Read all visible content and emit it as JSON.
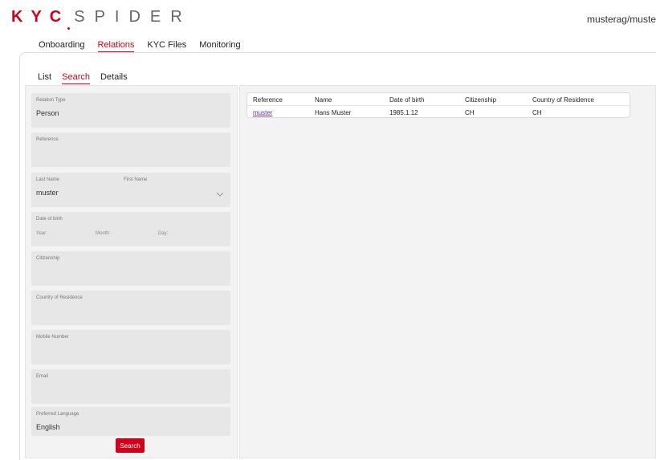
{
  "brand": {
    "left": "KYC",
    "right": "SPIDER"
  },
  "user": {
    "name": "musterag/muste"
  },
  "top_nav": [
    {
      "label": "Onboarding",
      "active": false
    },
    {
      "label": "Relations",
      "active": true
    },
    {
      "label": "KYC Files",
      "active": false
    },
    {
      "label": "Monitoring",
      "active": false
    }
  ],
  "sub_nav": [
    {
      "label": "List",
      "active": false
    },
    {
      "label": "Search",
      "active": true
    },
    {
      "label": "Details",
      "active": false
    }
  ],
  "form": {
    "relation_type": {
      "label": "Relation Type",
      "value": "Person"
    },
    "reference": {
      "label": "Reference",
      "value": ""
    },
    "last_name": {
      "label": "Last Name",
      "value": "muster"
    },
    "first_name": {
      "label": "First Name",
      "value": ""
    },
    "date_of_birth": {
      "label": "Date of birth",
      "year": "Year:",
      "month": "Month:",
      "day": "Day:"
    },
    "citizenship": {
      "label": "Citizenship",
      "value": ""
    },
    "country_of_residence": {
      "label": "Country of Residence",
      "value": ""
    },
    "mobile_number": {
      "label": "Mobile Number",
      "value": ""
    },
    "email": {
      "label": "Email",
      "value": ""
    },
    "preferred_language": {
      "label": "Preferred Language",
      "value": "English"
    },
    "search_label": "Search"
  },
  "results": {
    "columns": [
      "Reference",
      "Name",
      "Date of birth",
      "Citizenship",
      "Country of Residence"
    ],
    "rows": [
      [
        "muster",
        "Hans Muster",
        "1985.1.12",
        "CH",
        "CH"
      ]
    ]
  },
  "colors": {
    "accent": "#d0021b",
    "link": "#6a2ea0",
    "panel_bg": "#f3f3f3",
    "field_bg": "#e7e7e7"
  }
}
